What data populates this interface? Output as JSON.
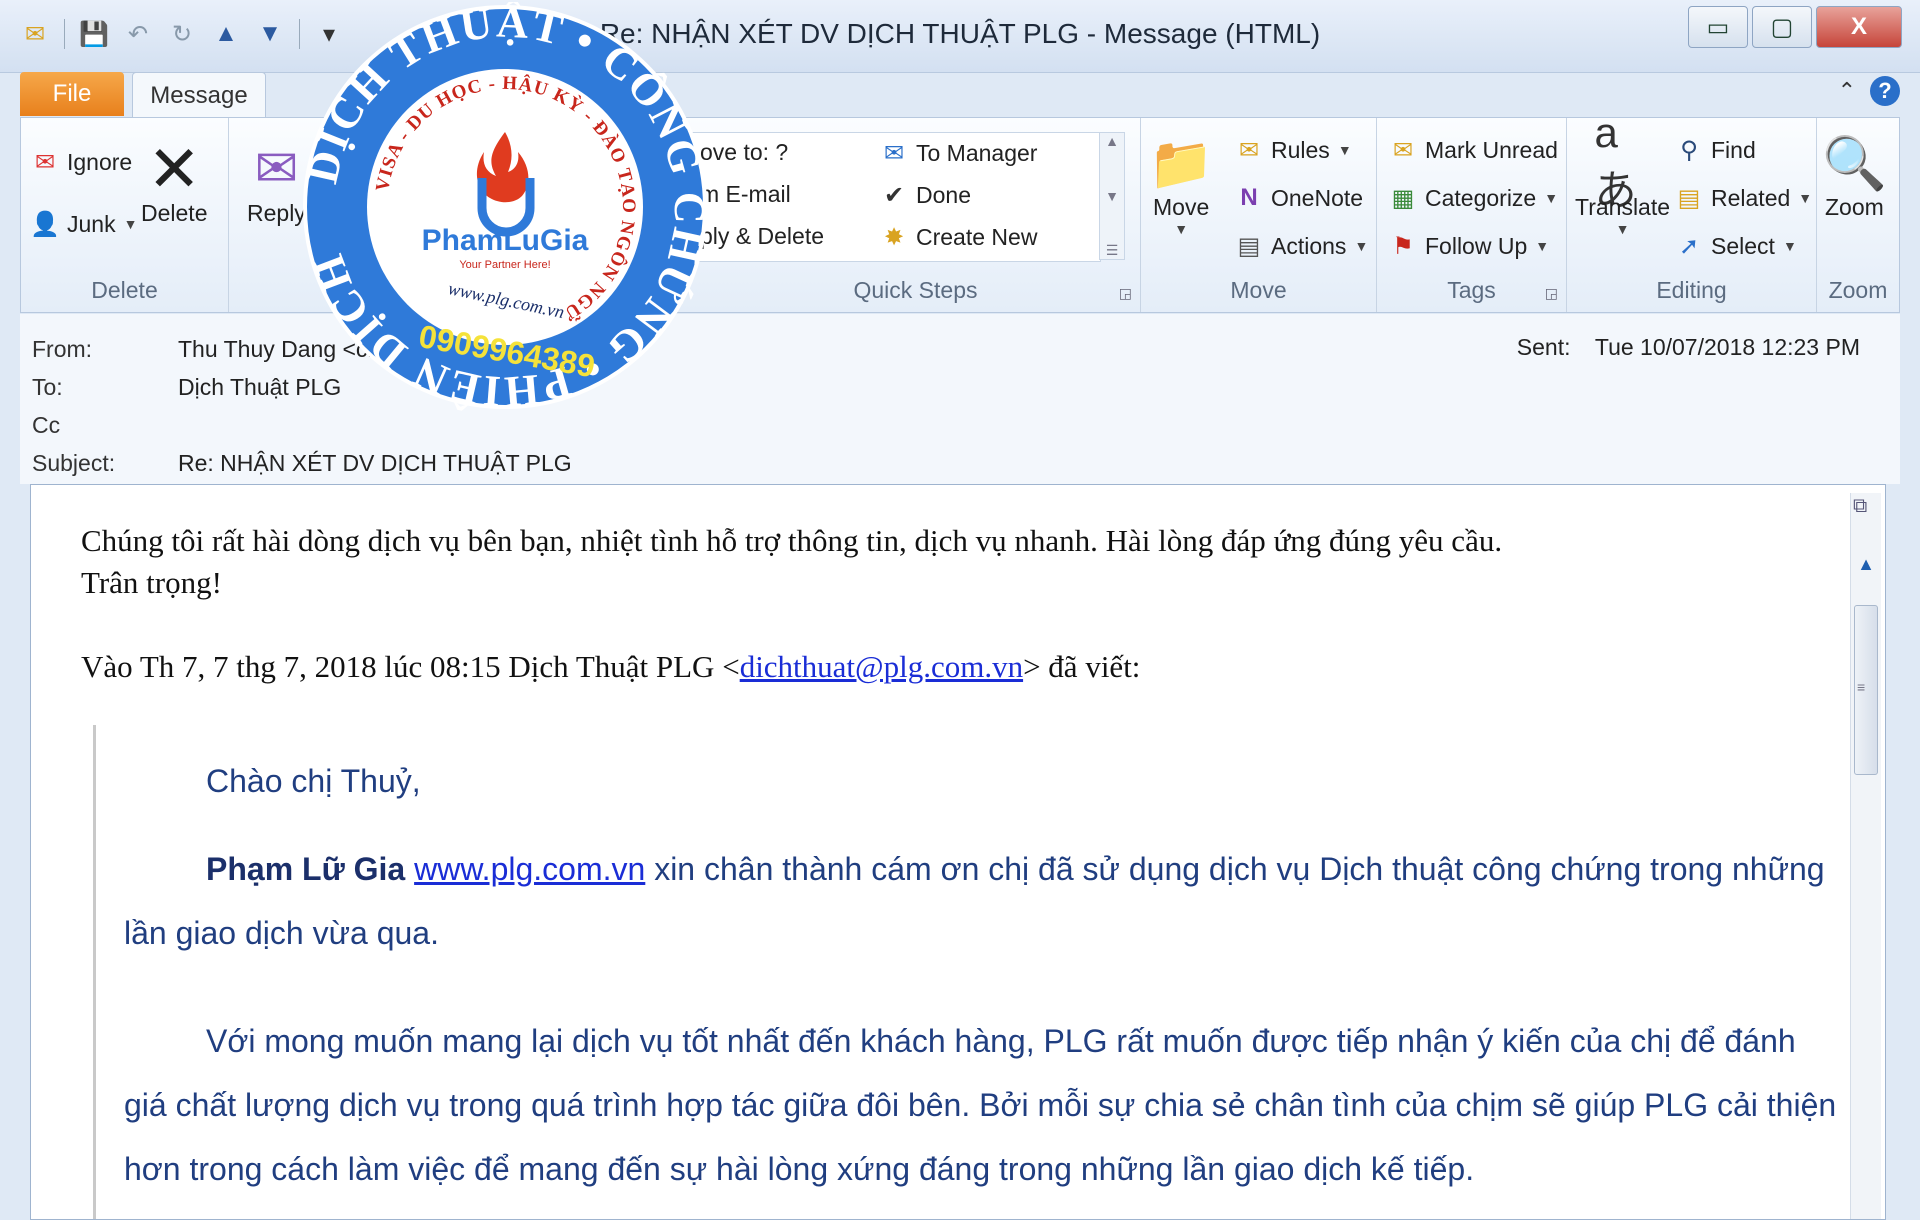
{
  "window": {
    "title": "Re: NHẬN XÉT DV DỊCH THUẬT PLG  -  Message (HTML)",
    "controls": {
      "minimize": "▭",
      "maximize": "▢",
      "close": "X"
    }
  },
  "qat": {
    "icons": [
      "mail-icon",
      "save-icon",
      "undo-icon",
      "redo-icon",
      "up-icon",
      "down-icon",
      "customize-icon"
    ],
    "glyphs": [
      "✉",
      "💾",
      "↶",
      "↻",
      "▲",
      "▼",
      "▾"
    ]
  },
  "tabs": {
    "file": "File",
    "message": "Message"
  },
  "ribbon": {
    "delete_group": {
      "label": "Delete",
      "ignore": "Ignore",
      "junk": "Junk",
      "delete": "Delete"
    },
    "respond_group": {
      "reply": "Reply"
    },
    "quick_steps": {
      "label": "Quick Steps",
      "items_left": [
        "ove to: ?",
        "m E-mail",
        "ply & Delete"
      ],
      "items_right": [
        "To Manager",
        "Done",
        "Create New"
      ]
    },
    "move_group": {
      "label": "Move",
      "move": "Move",
      "rules": "Rules",
      "onenote": "OneNote",
      "actions": "Actions"
    },
    "tags_group": {
      "label": "Tags",
      "mark_unread": "Mark Unread",
      "categorize": "Categorize",
      "follow_up": "Follow Up"
    },
    "editing_group": {
      "label": "Editing",
      "translate": "Translate",
      "find": "Find",
      "related": "Related",
      "select": "Select"
    },
    "zoom_group": {
      "label": "Zoom",
      "zoom": "Zoom"
    }
  },
  "header": {
    "from_label": "From:",
    "from_value": "Thu Thuy Dang <cntp",
    "to_label": "To:",
    "to_value": "Dịch Thuật PLG",
    "cc_label": "Cc",
    "subject_label": "Subject:",
    "subject_value": "Re: NHẬN XÉT DV DỊCH THUẬT PLG",
    "sent_label": "Sent:",
    "sent_value": "Tue 10/07/2018 12:23 PM"
  },
  "body": {
    "line1": "Chúng tôi rất hài dòng dịch vụ bên bạn, nhiệt tình hỗ trợ thông tin, dịch vụ nhanh. Hài lòng đáp ứng đúng yêu cầu.",
    "line2": "Trân trọng!",
    "quote_intro_before": "Vào Th 7, 7 thg 7, 2018 lúc 08:15 Dịch Thuật PLG <",
    "quote_intro_email": "dichthuat@plg.com.vn",
    "quote_intro_after": "> đã viết:",
    "greeting": "Chào chị Thuỷ,",
    "p1_bold": "Phạm Lữ Gia",
    "p1_link": "www.plg.com.vn",
    "p1_rest": " xin chân thành cám ơn chị đã sử dụng dịch vụ Dịch thuật công chứng trong những lần giao dịch vừa qua.",
    "p2": "Với mong muốn mang lại dịch vụ tốt nhất đến khách hàng, PLG rất muốn được tiếp nhận ý kiến của chị để đánh giá chất lượng dịch vụ trong quá trình hợp tác giữa đôi bên. Bởi mỗi sự chia sẻ chân tình của chịm sẽ giúp PLG cải thiện hơn trong cách làm việc để mang đến sự hài lòng xứng đáng trong những lần giao dịch kế tiếp."
  },
  "stamp": {
    "outer_text": "DỊCH THUẬT • CÔNG CHỨNG • PHIÊN DỊCH",
    "inner_text": "VISA - DU HỌC - HẬU KỲ - ĐÀO TẠO NGÔN NGỮ",
    "brand": "PhamLuGia",
    "tagline": "Your Partner Here!",
    "website": "www.plg.com.vn",
    "phone": "0909964389"
  },
  "colors": {
    "file_tab": "#e8801c",
    "stamp_blue": "#2f7ad9",
    "quote_text": "#203e80",
    "link": "#1a2dd6"
  }
}
